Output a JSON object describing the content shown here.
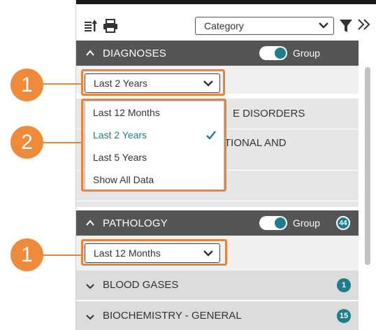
{
  "toolbar": {
    "icons": [
      "sort-export-icon",
      "print-icon",
      "filter-icon",
      "double-chevron-right-icon"
    ],
    "category_select": {
      "value": "Category"
    }
  },
  "diagnoses": {
    "title": "DIAGNOSES",
    "group_label": "Group",
    "group_toggle": true,
    "date_filter": "Last 2 Years",
    "dropdown": {
      "options": [
        "Last 12 Months",
        "Last 2 Years",
        "Last 5 Years",
        "Show All Data"
      ],
      "selected": "Last 2 Years"
    },
    "partially_hidden_rows": [
      "E DISORDERS",
      "TIONAL AND"
    ]
  },
  "pathology": {
    "title": "PATHOLOGY",
    "group_label": "Group",
    "group_toggle": true,
    "count": "44",
    "date_filter": "Last 12 Months",
    "rows": [
      {
        "label": "BLOOD GASES",
        "count": "1"
      },
      {
        "label": "BIOCHEMISTRY - GENERAL",
        "count": "15"
      }
    ]
  },
  "callouts": {
    "marker_1": "1",
    "marker_2": "2"
  },
  "colors": {
    "accent": "#1e7d8a",
    "header_bg": "#555555",
    "callout": "#ee8a3a"
  }
}
